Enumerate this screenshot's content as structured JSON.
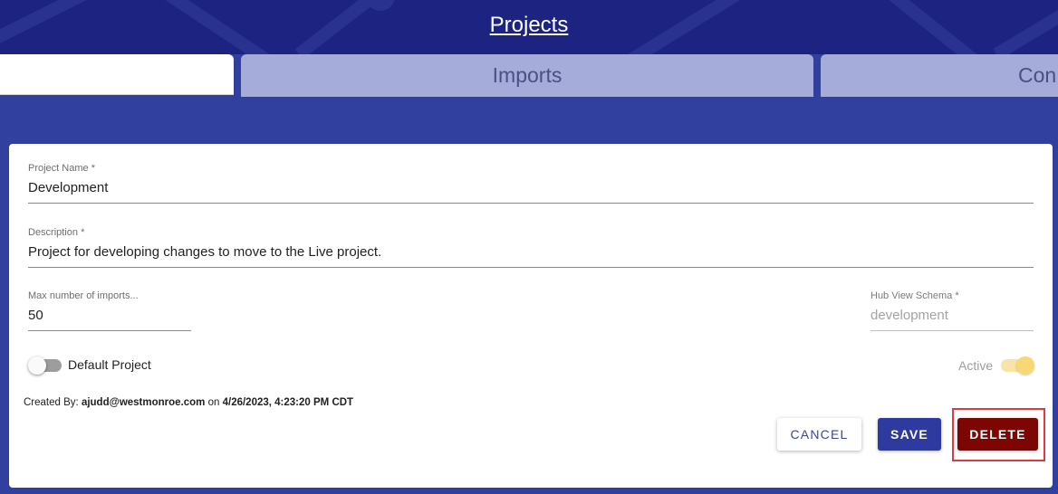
{
  "header": {
    "title": "Projects"
  },
  "tabs": [
    {
      "label": ""
    },
    {
      "label": "Imports"
    },
    {
      "label": "Con"
    }
  ],
  "form": {
    "project_name": {
      "label": "Project Name *",
      "value": "Development"
    },
    "description": {
      "label": "Description *",
      "value": "Project for developing changes to move to the Live project."
    },
    "max_imports": {
      "label": "Max number of imports...",
      "value": "50"
    },
    "hub_view_schema": {
      "label": "Hub View Schema *",
      "value": "development"
    },
    "default_project": {
      "label": "Default Project",
      "checked": false
    },
    "active": {
      "label": "Active",
      "checked": true
    }
  },
  "meta": {
    "created_by_prefix": "Created By:",
    "created_by_email": "ajudd@westmonroe.com",
    "on_text": "on",
    "created_at": "4/26/2023, 4:23:20 PM CDT"
  },
  "actions": {
    "cancel_label": "CANCEL",
    "save_label": "SAVE",
    "delete_label": "DELETE"
  },
  "colors": {
    "header_bg": "#1c2380",
    "page_bg": "#313f9e",
    "tab_inactive": "#a6acd9",
    "save": "#2e3a9f",
    "delete": "#7d0504",
    "toggle_active": "#f9d773",
    "highlight": "#e0393e"
  }
}
